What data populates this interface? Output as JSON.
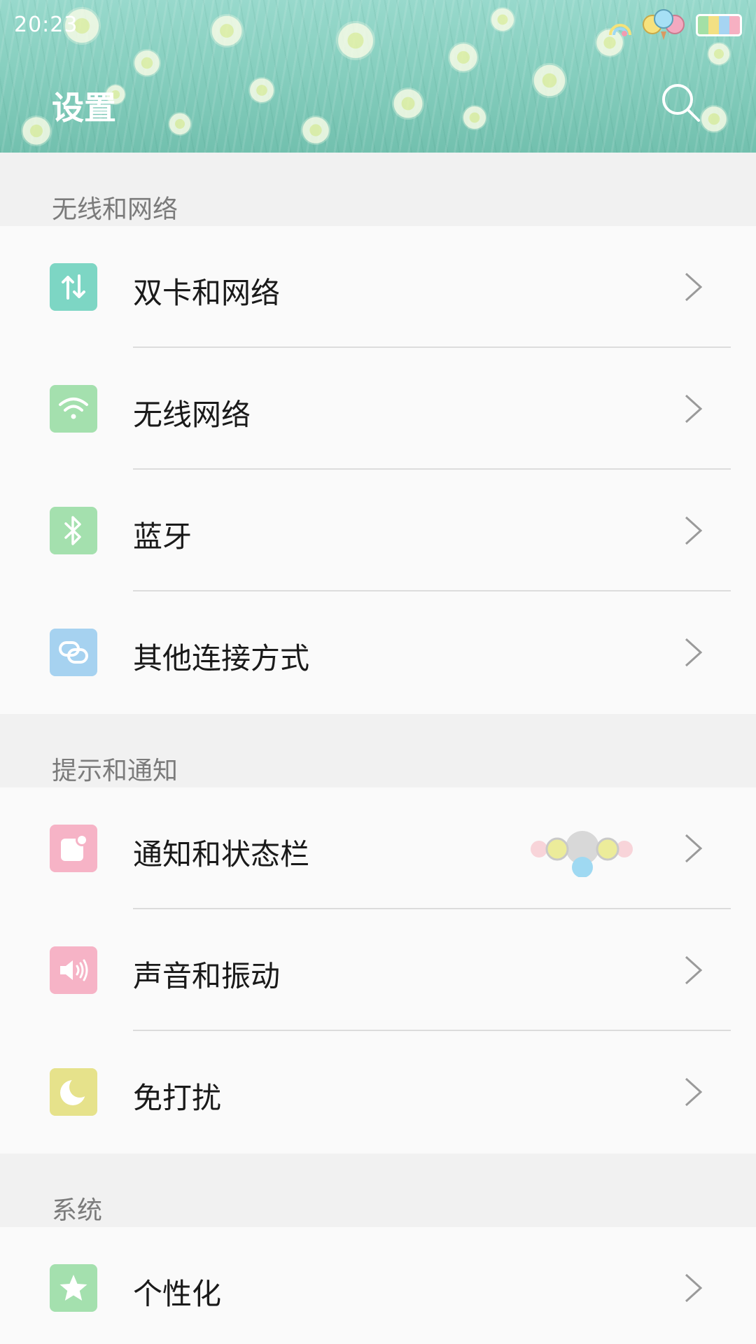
{
  "status_bar": {
    "time": "20:23"
  },
  "header": {
    "title": "设置",
    "search_icon": "search-icon"
  },
  "sections": [
    {
      "title": "无线和网络",
      "items": [
        {
          "label": "双卡和网络",
          "icon": "dual-sim-icon",
          "color": "#7dd6c4"
        },
        {
          "label": "无线网络",
          "icon": "wifi-icon",
          "color": "#a4e0ae"
        },
        {
          "label": "蓝牙",
          "icon": "bluetooth-icon",
          "color": "#a4e0ae"
        },
        {
          "label": "其他连接方式",
          "icon": "link-icon",
          "color": "#a6d2f0"
        }
      ]
    },
    {
      "title": "提示和通知",
      "items": [
        {
          "label": "通知和状态栏",
          "icon": "notification-icon",
          "color": "#f6b3c6"
        },
        {
          "label": "声音和振动",
          "icon": "sound-icon",
          "color": "#f6b3c6"
        },
        {
          "label": "免打扰",
          "icon": "moon-icon",
          "color": "#e6e28b"
        }
      ]
    },
    {
      "title": "系统",
      "items": [
        {
          "label": "个性化",
          "icon": "star-icon",
          "color": "#a4e0ae"
        }
      ]
    }
  ]
}
